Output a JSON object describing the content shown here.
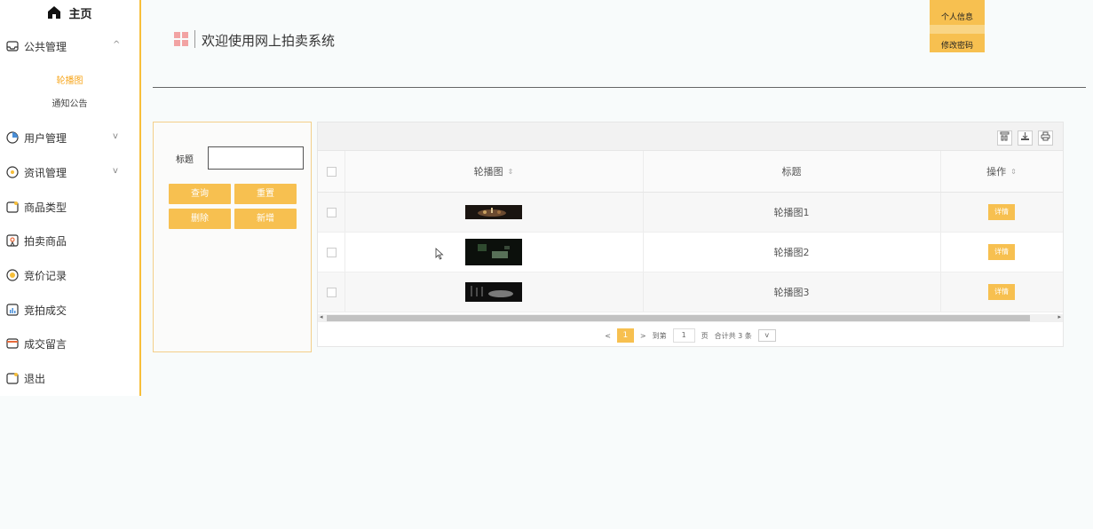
{
  "sidebar": {
    "home": "主页",
    "items": [
      {
        "label": "公共管理",
        "chevron": "^"
      },
      {
        "label": "用户管理",
        "chevron": "v"
      },
      {
        "label": "资讯管理",
        "chevron": "v"
      },
      {
        "label": "商品类型"
      },
      {
        "label": "拍卖商品"
      },
      {
        "label": "竞价记录"
      },
      {
        "label": "竞拍成交"
      },
      {
        "label": "成交留言"
      },
      {
        "label": "退出"
      }
    ],
    "subitems": [
      {
        "label": "轮播图",
        "active": true
      },
      {
        "label": "通知公告",
        "active": false
      }
    ],
    "accent_color": "#f7bf3a"
  },
  "header": {
    "title": "欢迎使用网上拍卖系统",
    "user_menu": [
      "个人信息",
      "修改密码"
    ]
  },
  "search": {
    "label": "标题",
    "input_value": "",
    "buttons": {
      "query": "查询",
      "reset": "重置",
      "delete": "删除",
      "add": "新增"
    }
  },
  "table": {
    "columns": [
      "轮播图",
      "标题",
      "操作"
    ],
    "rows": [
      {
        "title": "轮播图1",
        "action": "详情"
      },
      {
        "title": "轮播图2",
        "action": "详情"
      },
      {
        "title": "轮播图3",
        "action": "详情"
      }
    ]
  },
  "pagination": {
    "prev": "<",
    "current_page": "1",
    "next": ">",
    "goto_label": "到第",
    "goto_value": "1",
    "page_unit": "页",
    "total_text": "合计共 3 条",
    "select_value": "v"
  }
}
